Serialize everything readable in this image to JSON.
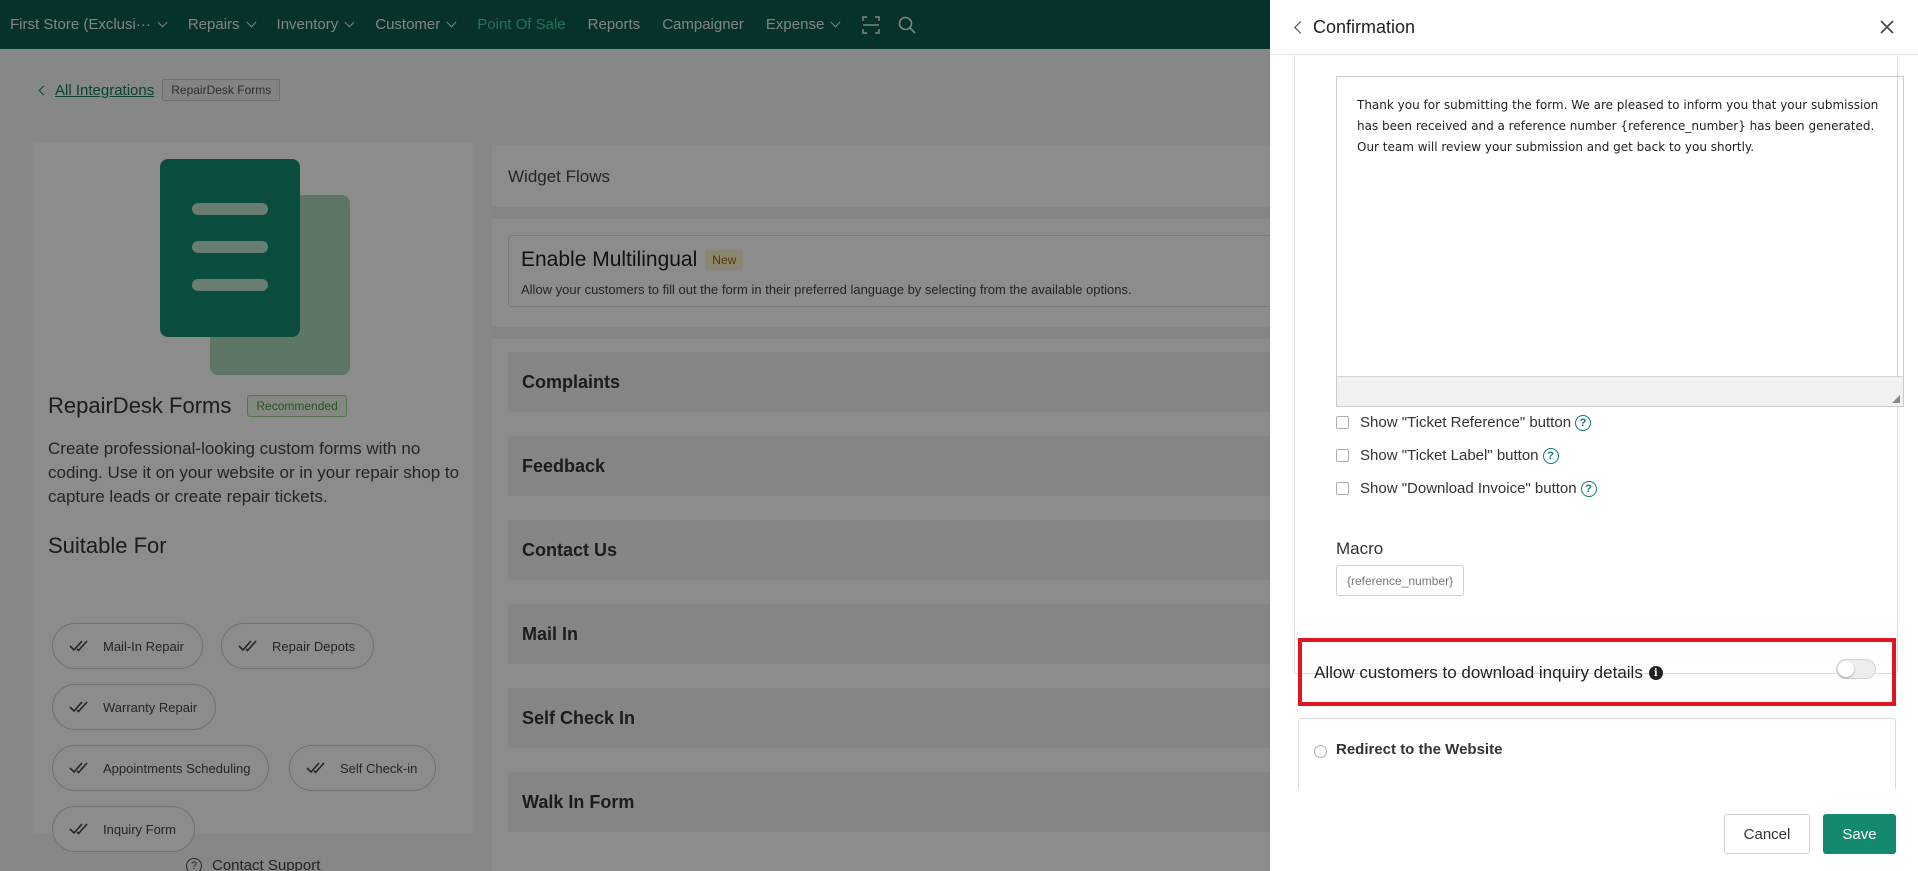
{
  "nav": {
    "items": [
      {
        "label": "First Store (Exclusi···",
        "dropdown": true,
        "active": false
      },
      {
        "label": "Repairs",
        "dropdown": true,
        "active": false
      },
      {
        "label": "Inventory",
        "dropdown": true,
        "active": false
      },
      {
        "label": "Customer",
        "dropdown": true,
        "active": false
      },
      {
        "label": "Point Of Sale",
        "dropdown": false,
        "active": true
      },
      {
        "label": "Reports",
        "dropdown": false,
        "active": false
      },
      {
        "label": "Campaigner",
        "dropdown": false,
        "active": false
      },
      {
        "label": "Expense",
        "dropdown": true,
        "active": false
      }
    ],
    "icons": [
      "scan-icon",
      "search-icon"
    ]
  },
  "breadcrumb": {
    "link": "All Integrations",
    "current": "RepairDesk Forms"
  },
  "product": {
    "name": "RepairDesk Forms",
    "badge": "Recommended",
    "description": "Create professional-looking custom forms with no coding. Use it on your website or in your repair shop to capture leads or create repair tickets.",
    "suitable_title": "Suitable For",
    "suitable_for": [
      "Mail-In Repair",
      "Repair Depots",
      "Warranty Repair",
      "Appointments Scheduling",
      "Self Check-in",
      "Inquiry Form"
    ],
    "support": "Contact Support"
  },
  "widget": {
    "title": "Widget Flows",
    "multilingual": {
      "title": "Enable Multilingual",
      "badge": "New",
      "description": "Allow your customers to fill out the form in their preferred language by selecting from the available options."
    },
    "flows": [
      "Complaints",
      "Feedback",
      "Contact Us",
      "Mail In",
      "Self Check In",
      "Walk In Form"
    ]
  },
  "drawer": {
    "title": "Confirmation",
    "message": "Thank you for submitting the form. We are pleased to inform you that your submission has been received and a reference number {reference_number} has been generated. Our team will review your submission and get back to you shortly.",
    "checkboxes": [
      {
        "label": "Show \"Ticket Reference\" button",
        "checked": false
      },
      {
        "label": "Show \"Ticket Label\" button",
        "checked": false
      },
      {
        "label": "Show \"Download Invoice\" button",
        "checked": false
      }
    ],
    "macro_label": "Macro",
    "macro_value": "{reference_number}",
    "download_label": "Allow customers to download inquiry details",
    "download_enabled": false,
    "redirect_label": "Redirect to the Website",
    "cancel_label": "Cancel",
    "save_label": "Save"
  },
  "colors": {
    "nav_bg": "#0e5c4f",
    "accent": "#138a6f",
    "active_nav": "#3fd1a5",
    "highlight": "#e0161e"
  }
}
